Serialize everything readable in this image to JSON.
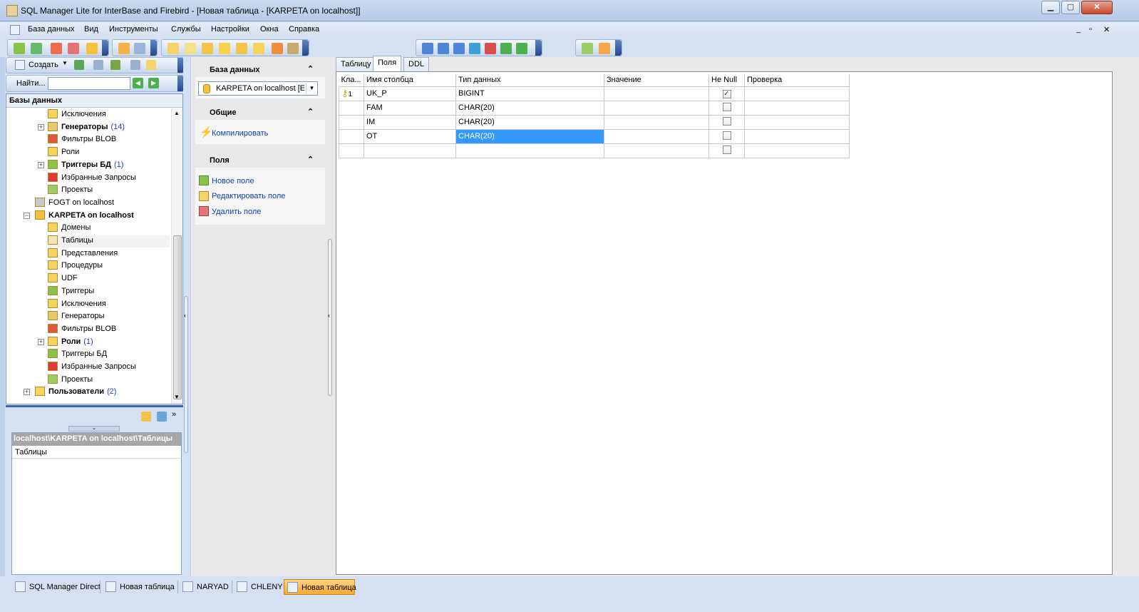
{
  "window": {
    "title": "SQL Manager Lite for InterBase and Firebird - [Новая таблица - [KARPETA on localhost]]",
    "minimize": "▁",
    "maximize": "▢",
    "close": "✕",
    "mdi_controls": [
      "_",
      "▫",
      "✕"
    ]
  },
  "menu": [
    "База данных",
    "Вид",
    "Инструменты",
    "Службы",
    "Настройки",
    "Окна",
    "Справка"
  ],
  "left": {
    "create_label": "Создать",
    "search_label": "Найти...",
    "search_value": "",
    "tree_header": "Базы данных",
    "tree": [
      {
        "label": "Исключения",
        "count": "",
        "bold": false,
        "icon": "exceptions-icon",
        "color": "#f6d35a"
      },
      {
        "label": "Генераторы",
        "count": "(14)",
        "bold": true,
        "icon": "generators-icon",
        "color": "#e8c86a",
        "expander": "+"
      },
      {
        "label": "Фильтры BLOB",
        "count": "",
        "bold": false,
        "icon": "blob-filters-icon",
        "color": "#e05a3a"
      },
      {
        "label": "Роли",
        "count": "",
        "bold": false,
        "icon": "roles-icon",
        "color": "#f6d35a"
      },
      {
        "label": "Триггеры БД",
        "count": "(1)",
        "bold": true,
        "icon": "db-triggers-icon",
        "color": "#8bc34a",
        "expander": "+"
      },
      {
        "label": "Избранные Запросы",
        "count": "",
        "bold": false,
        "icon": "favorite-queries-icon",
        "color": "#e53935"
      },
      {
        "label": "Проекты",
        "count": "",
        "bold": false,
        "icon": "projects-icon",
        "color": "#9ccc65"
      },
      {
        "label": "FOGT on localhost",
        "count": "",
        "bold": false,
        "icon": "database-icon",
        "color": "#c8c8c8",
        "level": 1
      },
      {
        "label": "KARPETA on localhost",
        "count": "",
        "bold": true,
        "icon": "database-active-icon",
        "color": "#f6c13a",
        "level": 1,
        "expander": "−"
      },
      {
        "label": "Домены",
        "count": "",
        "bold": false,
        "icon": "domains-icon",
        "color": "#f6d35a"
      },
      {
        "label": "Таблицы",
        "count": "",
        "bold": false,
        "icon": "tables-icon",
        "color": "#f3e6b0",
        "selected": true
      },
      {
        "label": "Представления",
        "count": "",
        "bold": false,
        "icon": "views-icon",
        "color": "#f6d35a"
      },
      {
        "label": "Процедуры",
        "count": "",
        "bold": false,
        "icon": "procedures-icon",
        "color": "#f6d35a"
      },
      {
        "label": "UDF",
        "count": "",
        "bold": false,
        "icon": "udf-icon",
        "color": "#f6d35a"
      },
      {
        "label": "Триггеры",
        "count": "",
        "bold": false,
        "icon": "triggers-icon",
        "color": "#8bc34a"
      },
      {
        "label": "Исключения",
        "count": "",
        "bold": false,
        "icon": "exceptions-icon",
        "color": "#f6d35a"
      },
      {
        "label": "Генераторы",
        "count": "",
        "bold": false,
        "icon": "generators-icon",
        "color": "#e8c86a"
      },
      {
        "label": "Фильтры BLOB",
        "count": "",
        "bold": false,
        "icon": "blob-filters-icon",
        "color": "#e05a3a"
      },
      {
        "label": "Роли",
        "count": "(1)",
        "bold": true,
        "icon": "roles-icon",
        "color": "#f6d35a",
        "expander": "+"
      },
      {
        "label": "Триггеры БД",
        "count": "",
        "bold": false,
        "icon": "db-triggers-icon",
        "color": "#8bc34a"
      },
      {
        "label": "Избранные Запросы",
        "count": "",
        "bold": false,
        "icon": "favorite-queries-icon",
        "color": "#e53935"
      },
      {
        "label": "Проекты",
        "count": "",
        "bold": false,
        "icon": "projects-icon",
        "color": "#9ccc65"
      },
      {
        "label": "Пользователи",
        "count": "(2)",
        "bold": true,
        "icon": "users-icon",
        "color": "#f6d35a",
        "level": 1,
        "expander": "+"
      }
    ],
    "info_path": "localhost\\KARPETA on localhost\\Таблицы",
    "info_item": "Таблицы"
  },
  "nav": {
    "db_section": "База данных",
    "db_select": "KARPETA on localhost [E:\\",
    "general_section": "Общие",
    "compile": "Компилировать",
    "fields_section": "Поля",
    "new_field": "Новое поле",
    "edit_field": "Редактировать поле",
    "delete_field": "Удалить поле",
    "collapse_glyph": "⌃"
  },
  "tabs": [
    "Таблицу",
    "Поля",
    "DDL"
  ],
  "grid": {
    "headers": [
      "Кла...",
      "Имя столбца",
      "Тип данных",
      "Значение",
      "He Null",
      "Проверка"
    ],
    "rows": [
      {
        "key": "1",
        "name": "UK_P",
        "type": "BIGINT",
        "value": "",
        "notnull": "✓",
        "check": ""
      },
      {
        "key": "",
        "name": "FAM",
        "type": "CHAR(20)",
        "value": "",
        "notnull": "",
        "check": ""
      },
      {
        "key": "",
        "name": "IM",
        "type": "CHAR(20)",
        "value": "",
        "notnull": "",
        "check": ""
      },
      {
        "key": "",
        "name": "OT",
        "type": "CHAR(20)",
        "value": "",
        "notnull": "",
        "check": ""
      },
      {
        "key": "",
        "name": "",
        "type": "",
        "value": "",
        "notnull": "",
        "check": ""
      }
    ]
  },
  "taskbar": [
    {
      "label": "SQL Manager Direct",
      "active": false
    },
    {
      "label": "Новая таблица",
      "active": false
    },
    {
      "label": "NARYAD",
      "active": false
    },
    {
      "label": "CHLENY",
      "active": false
    },
    {
      "label": "Новая таблица",
      "active": true
    }
  ],
  "colors": {
    "selection": "#3399ff",
    "link": "#0b3fb5",
    "count": "#1b3fcf",
    "active_task": "#f7a832"
  }
}
